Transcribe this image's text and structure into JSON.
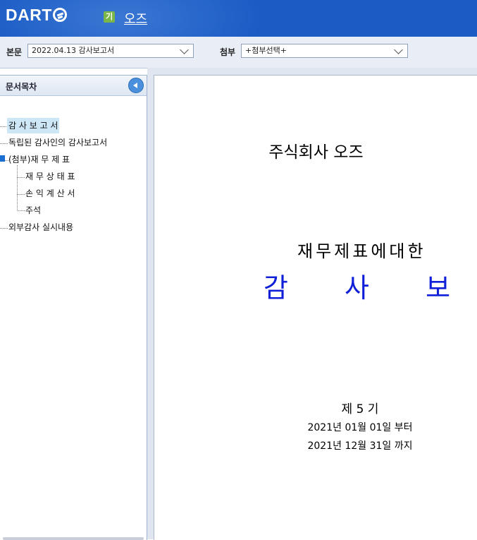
{
  "header": {
    "logo_text": "DART",
    "company_badge": "기",
    "company_name": "오즈"
  },
  "toolbar": {
    "main_label": "본문",
    "main_select_value": "2022.04.13  감사보고서",
    "attach_label": "첨부",
    "attach_select_value": "+첨부선택+"
  },
  "toc": {
    "title": "문서목차",
    "items": [
      {
        "label": "감 사 보 고 서"
      },
      {
        "label": "독립된 감사인의 감사보고서"
      },
      {
        "label": "(첨부)재 무 제 표"
      },
      {
        "label": "재 무 상 태 표"
      },
      {
        "label": "손 익 계 산 서"
      },
      {
        "label": "주석"
      },
      {
        "label": "외부감사 실시내용"
      }
    ]
  },
  "document": {
    "company": "주식회사 오즈",
    "for_title": "재무제표에대한",
    "audit_title": "감 사 보 고 서",
    "period": "제 5 기",
    "date_from": "2021년 01월 01일  부터",
    "date_to": "2021년 12월 31일  까지"
  }
}
